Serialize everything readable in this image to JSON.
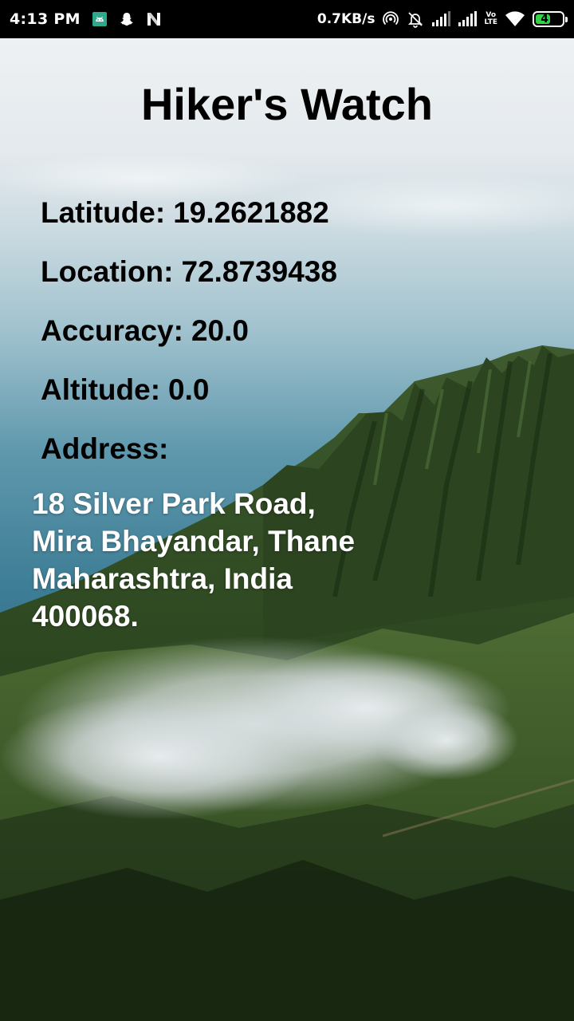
{
  "status_bar": {
    "time": "4:13 PM",
    "net_speed": "0.7KB/s",
    "volte_top": "Vo",
    "volte_bottom": "LTE",
    "battery_level": "47",
    "icons": [
      "android-debug-icon",
      "snapchat-icon",
      "n-notification-icon",
      "hotspot-icon",
      "mute-alarm-icon",
      "signal-icon",
      "signal-icon",
      "wifi-icon",
      "battery-icon"
    ],
    "battery_color": "#36d14a"
  },
  "app": {
    "title": "Hiker's Watch"
  },
  "info": {
    "latitude_label": "Latitude:",
    "latitude_value": "19.2621882",
    "location_label": "Location:",
    "location_value": "72.8739438",
    "accuracy_label": "Accuracy:",
    "accuracy_value": "20.0",
    "altitude_label": "Altitude:",
    "altitude_value": "0.0",
    "address_label": "Address:"
  },
  "address": {
    "line1": "18 Silver Park Road,",
    "line2": "Mira Bhayandar, Thane",
    "line3": "Maharashtra, India",
    "line4": "400068."
  },
  "colors": {
    "label_text": "#000000",
    "address_text": "#ffffff",
    "sea": "#3a7c94",
    "mountain": "#2d4a22"
  }
}
